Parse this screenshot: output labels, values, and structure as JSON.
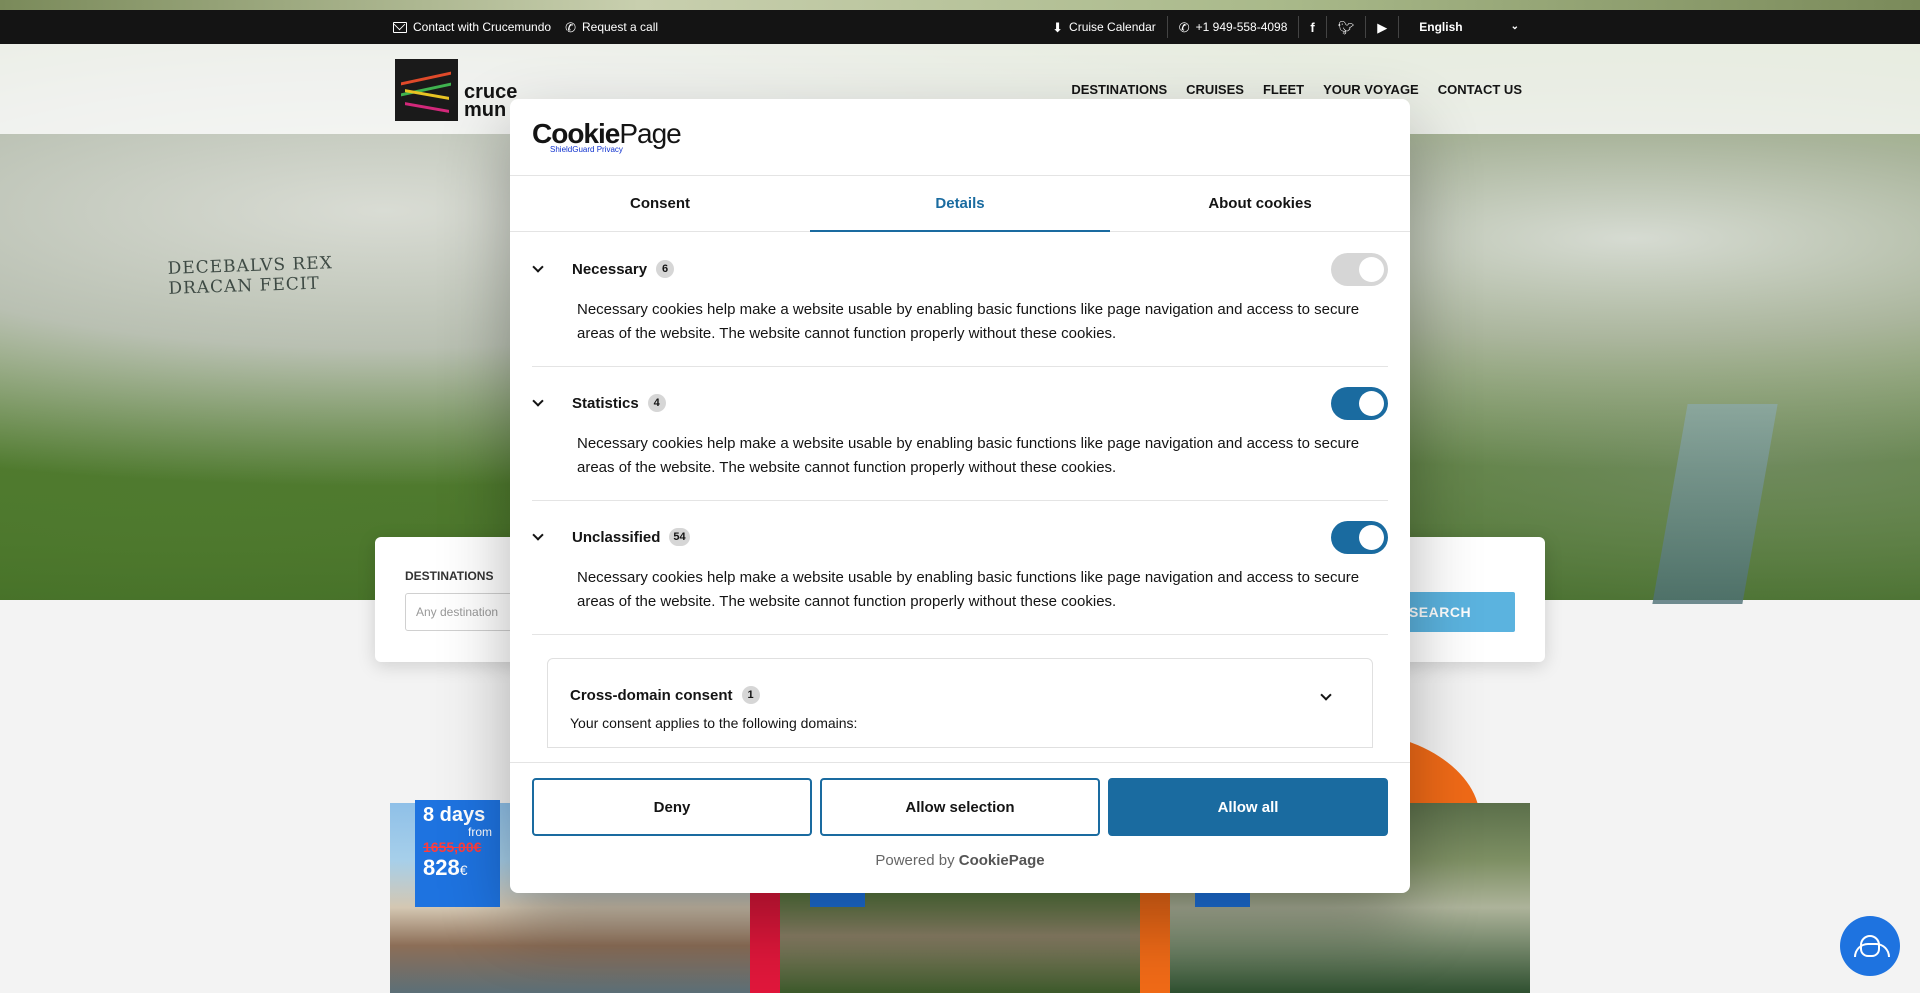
{
  "topbar": {
    "contact": "Contact with Crucemundo",
    "request_call": "Request a call",
    "calendar": "Cruise Calendar",
    "phone": "+1 949-558-4098",
    "language": "English"
  },
  "header": {
    "logo_line1": "cruce",
    "logo_line2": "mun",
    "nav": [
      "DESTINATIONS",
      "CRUISES",
      "FLEET",
      "YOUR VOYAGE",
      "CONTACT US"
    ]
  },
  "hero": {
    "rock_text_1": "DECEBALVS REX",
    "rock_text_2": "DRACAN FECIT"
  },
  "search": {
    "label": "DESTINATIONS",
    "placeholder": "Any destination",
    "button": "SEARCH"
  },
  "price_tag": {
    "days": "8 days",
    "from": "from",
    "old_price": "1655,00€",
    "new_price": "828",
    "currency": "€"
  },
  "cookie_dialog": {
    "brand_a": "Cookie",
    "brand_b": "Page",
    "brand_sub": "ShieldGuard Privacy",
    "tabs": [
      {
        "label": "Consent"
      },
      {
        "label": "Details",
        "active": true
      },
      {
        "label": "About cookies"
      }
    ],
    "sections": [
      {
        "title": "Necessary",
        "count": "6",
        "enabled": true,
        "locked": true,
        "description": "Necessary cookies help make a website usable by enabling basic functions like page navigation and access to secure areas of the website. The website cannot function properly without these cookies."
      },
      {
        "title": "Statistics",
        "count": "4",
        "enabled": true,
        "locked": false,
        "description": "Necessary cookies help make a website usable by enabling basic functions like page navigation and access to secure areas of the website. The website cannot function properly without these cookies."
      },
      {
        "title": "Unclassified",
        "count": "54",
        "enabled": true,
        "locked": false,
        "description": "Necessary cookies help make a website usable by enabling basic functions like page navigation and access to secure areas of the website. The website cannot function properly without these cookies."
      }
    ],
    "cross_domain": {
      "title": "Cross-domain consent",
      "count": "1",
      "description": "Your consent applies to the following domains:"
    },
    "buttons": {
      "deny": "Deny",
      "allow_selection": "Allow selection",
      "allow_all": "Allow all"
    },
    "powered_prefix": "Powered by",
    "powered_brand": "CookiePage"
  },
  "colors": {
    "accent": "#1a6ba0",
    "price_tag": "#1e73e0",
    "search_button": "#5bb3df"
  },
  "icons": [
    "mail-icon",
    "phone-icon",
    "download-icon",
    "facebook-icon",
    "twitter-icon",
    "youtube-icon",
    "chevron-down-icon",
    "support-agent-icon"
  ]
}
